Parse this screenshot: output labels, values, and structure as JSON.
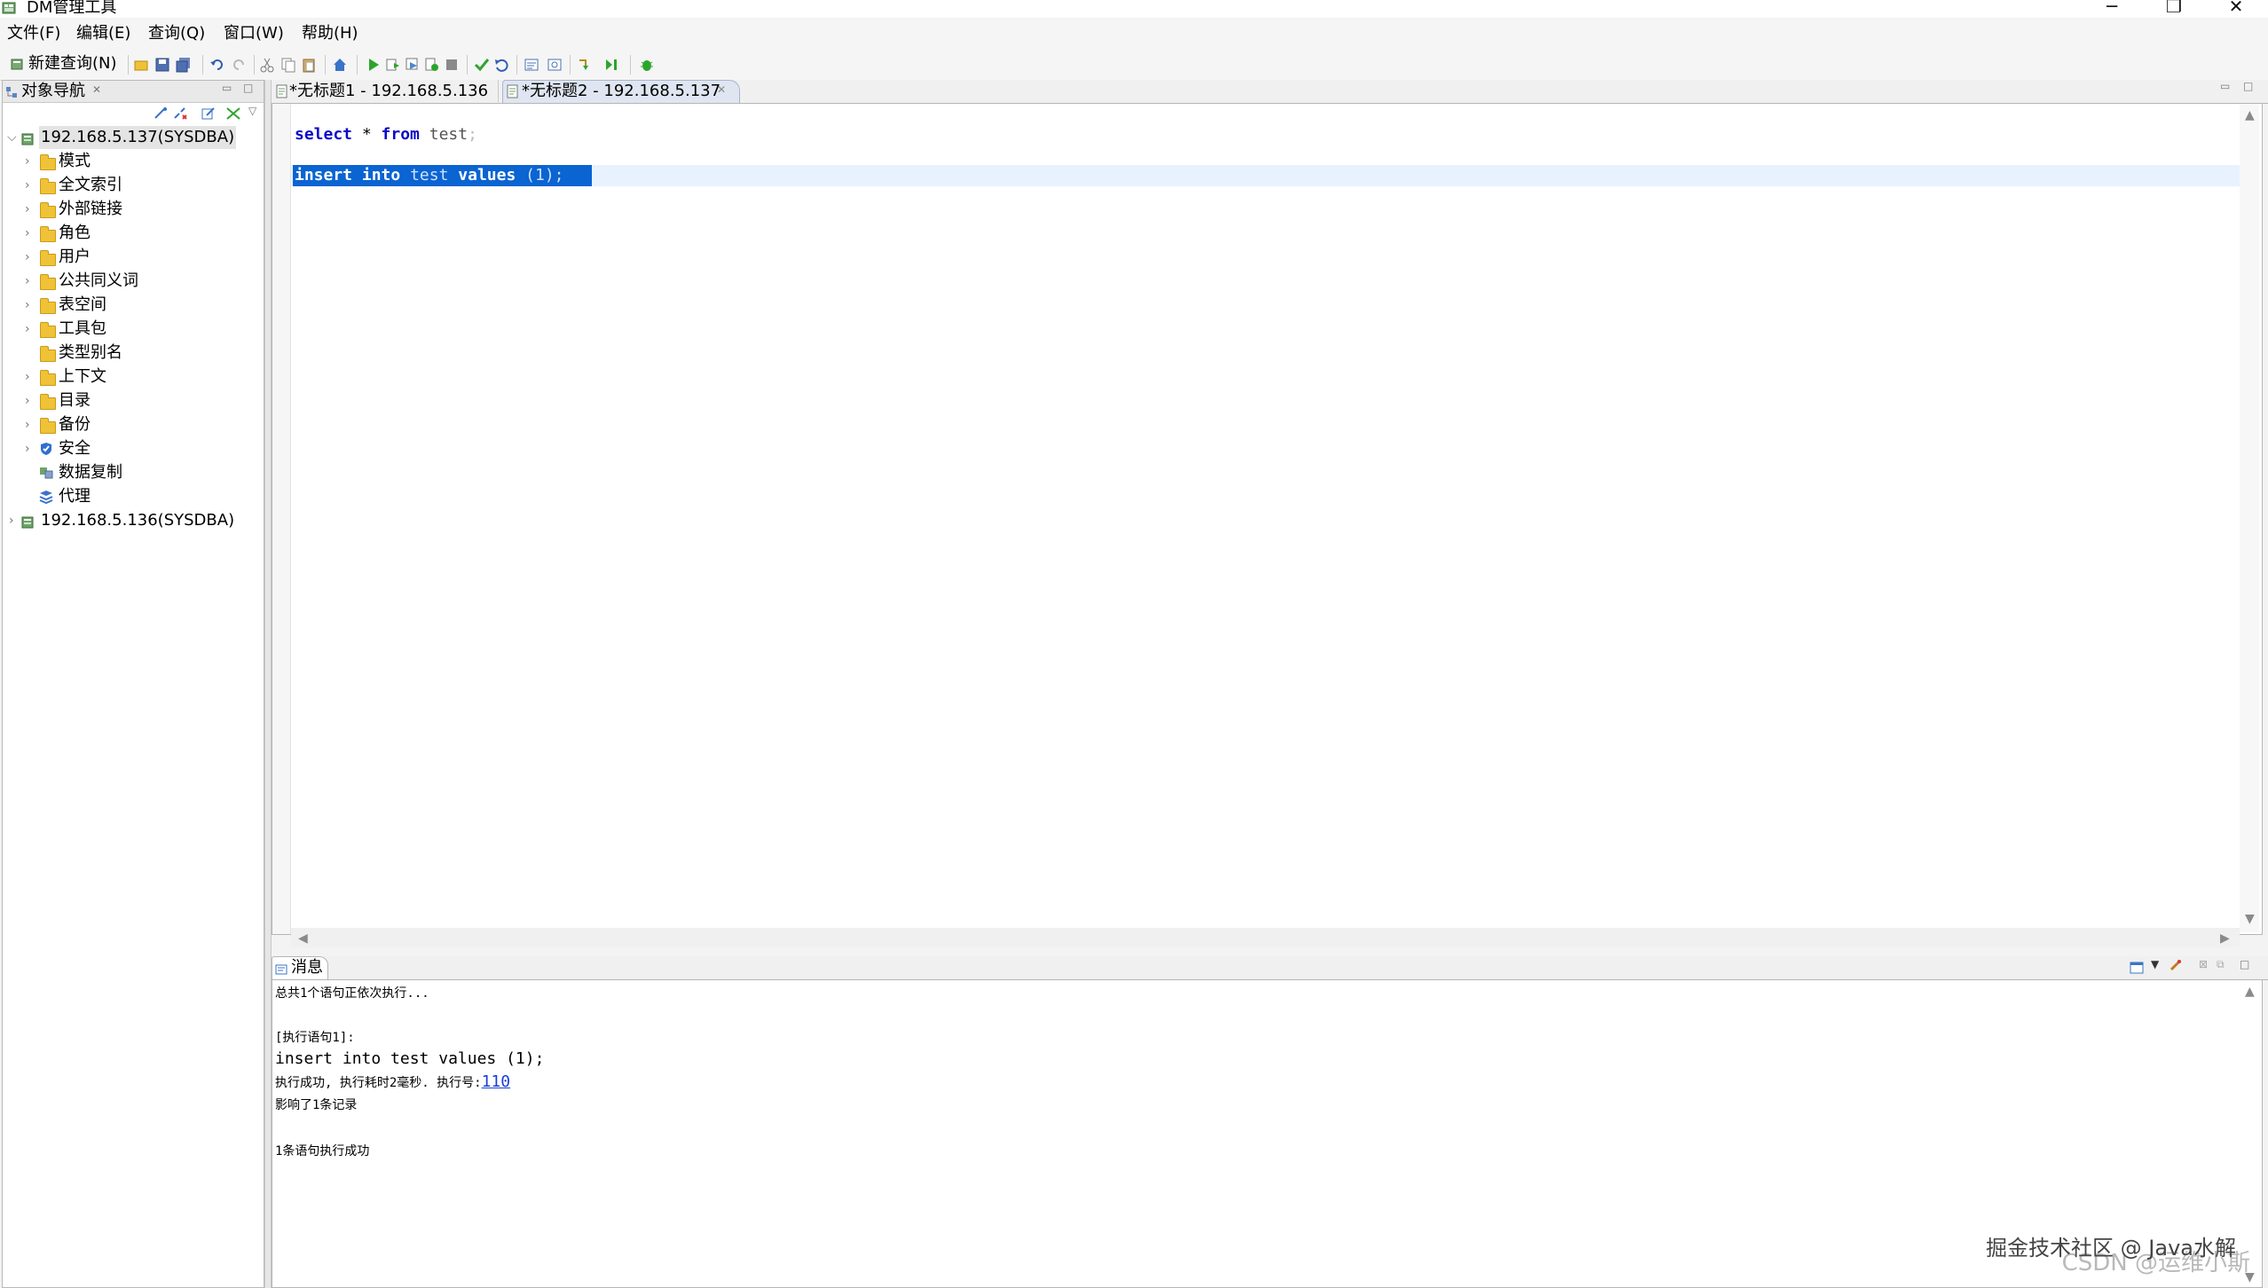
{
  "window": {
    "title": "DM管理工具"
  },
  "menu": [
    "文件(F)",
    "编辑(E)",
    "查询(Q)",
    "窗口(W)",
    "帮助(H)"
  ],
  "toolbar": {
    "new_query_label": "新建查询(N)"
  },
  "navigator": {
    "title": "对象导航",
    "connections": [
      {
        "label": "192.168.5.137(SYSDBA)",
        "expanded": true,
        "children": [
          "模式",
          "全文索引",
          "外部链接",
          "角色",
          "用户",
          "公共同义词",
          "表空间",
          "工具包",
          "类型别名",
          "上下文",
          "目录",
          "备份",
          "安全",
          "数据复制",
          "代理"
        ]
      },
      {
        "label": "192.168.5.136(SYSDBA)",
        "expanded": false
      }
    ]
  },
  "editor": {
    "tabs": [
      {
        "label": "*无标题1 - 192.168.5.136",
        "active": false
      },
      {
        "label": "*无标题2 - 192.168.5.137",
        "active": true
      }
    ],
    "lines": [
      {
        "kw1": "select",
        "t1": " * ",
        "kw2": "from",
        "t2": " test",
        "end": ";"
      },
      {
        "kw1": "insert",
        "kw2": "into",
        "t1": "test",
        "kw3": "values",
        "t2": "(1);"
      }
    ]
  },
  "messages": {
    "tab_label": "消息",
    "line1": "总共1个语句正依次执行...",
    "line2": "[执行语句1]:",
    "line3": "insert into test values (1);",
    "line4_prefix": "执行成功, 执行耗时2毫秒. 执行号:",
    "line4_link": "110",
    "line5": "影响了1条记录",
    "line6": "1条语句执行成功"
  },
  "watermark": {
    "csdn": "CSDN @运维小斯",
    "juejin": "掘金技术社区 @ Java水解"
  },
  "colors": {
    "selection": "#0a64d2",
    "keyword": "#0a0ac8",
    "folder": "#f0c237",
    "link": "#1a3fd6"
  }
}
